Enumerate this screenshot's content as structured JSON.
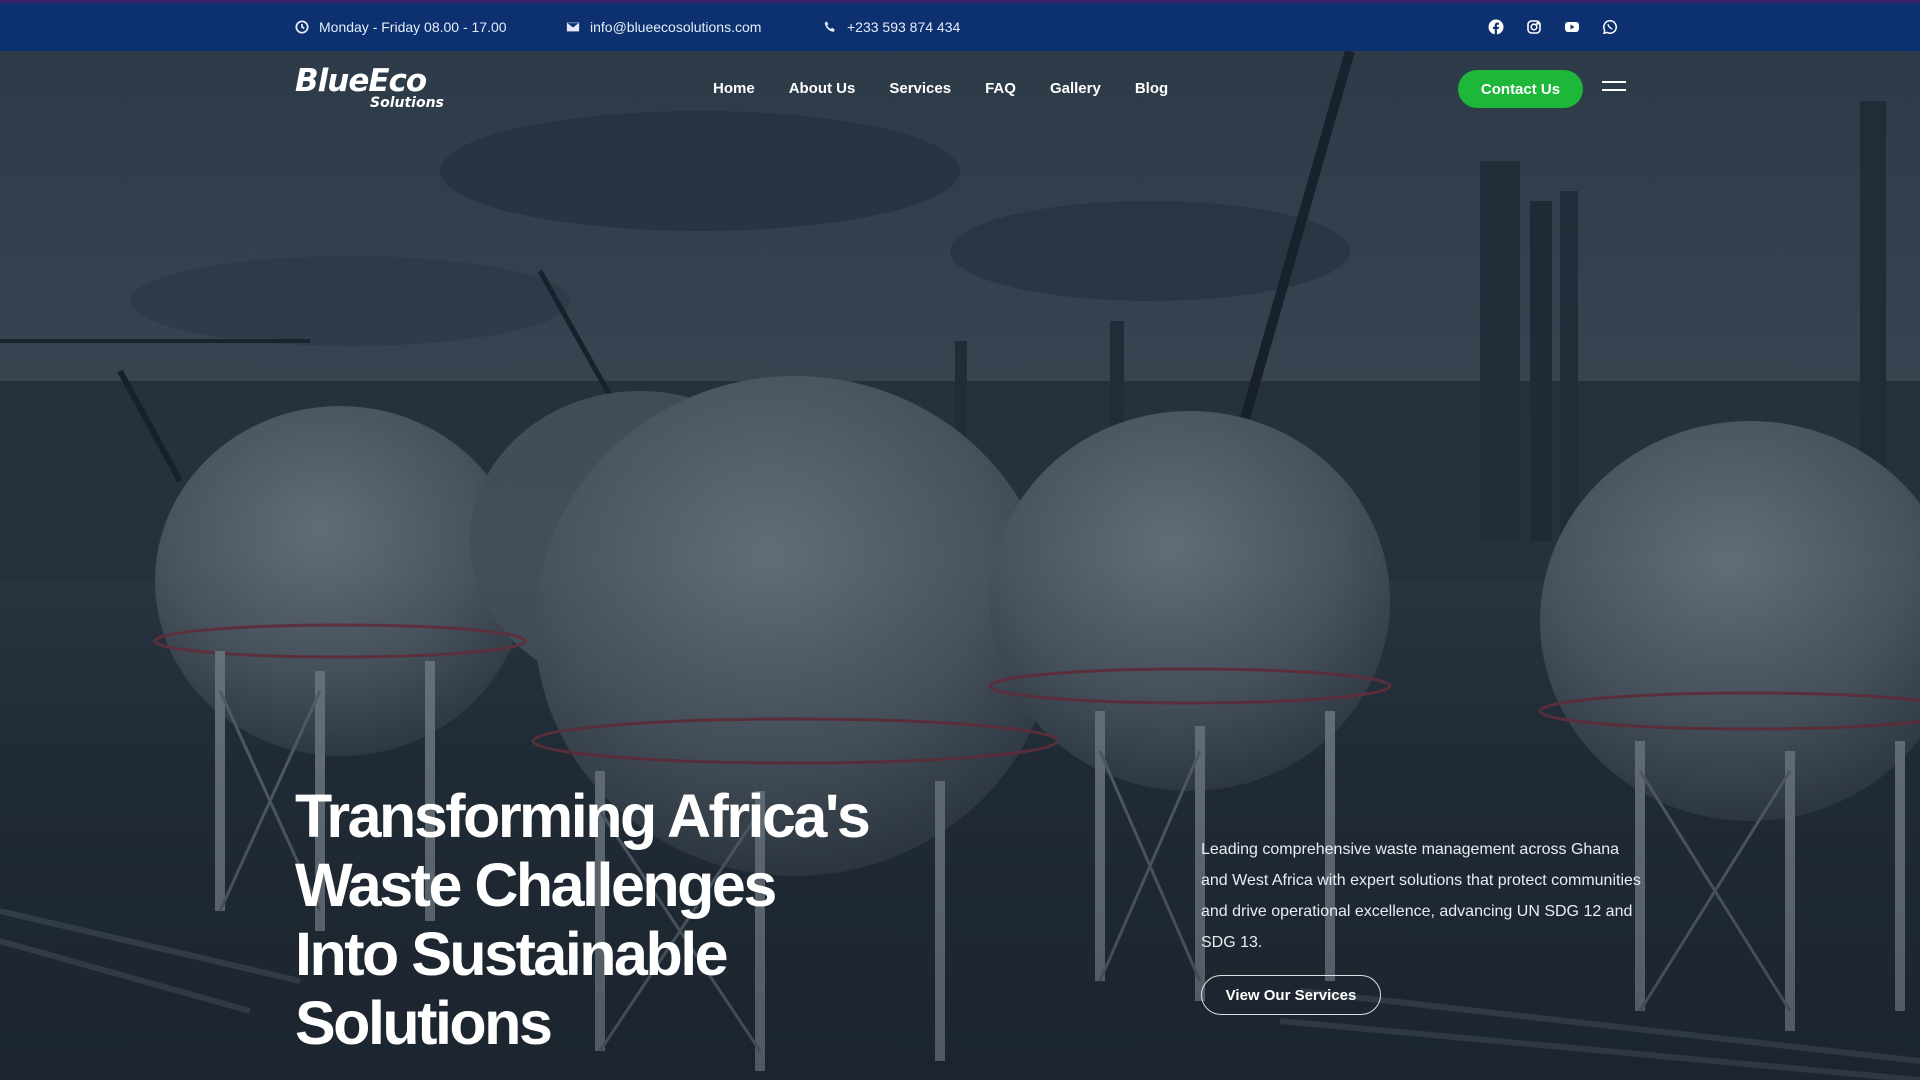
{
  "topbar": {
    "hours": "Monday - Friday 08.00 - 17.00",
    "email": "info@blueecosolutions.com",
    "phone": "+233 593 874 434",
    "socials": [
      "facebook-icon",
      "instagram-icon",
      "youtube-icon",
      "whatsapp-icon"
    ]
  },
  "nav": {
    "logo_main": "BlueEco",
    "logo_sub": "Solutions",
    "items": [
      "Home",
      "About Us",
      "Services",
      "FAQ",
      "Gallery",
      "Blog"
    ],
    "contact_label": "Contact Us"
  },
  "hero": {
    "headline_lines": [
      "Transforming Africa's",
      "Waste Challenges",
      "Into Sustainable",
      "Solutions"
    ],
    "description": "Leading comprehensive waste management across Ghana and West Africa with expert solutions that protect communities and drive operational excellence, advancing UN SDG 12 and SDG 13.",
    "cta_label": "View Our Services"
  },
  "colors": {
    "topbar_bg": "#0d3170",
    "accent_green": "#1db83a"
  }
}
